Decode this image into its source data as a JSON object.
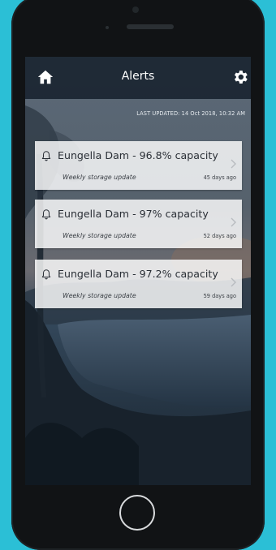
{
  "header": {
    "title": "Alerts",
    "left_icon": "home-icon",
    "right_icon": "gear-icon"
  },
  "last_updated": "LAST UPDATED: 14 Oct 2018, 10:32 AM",
  "alerts": [
    {
      "title": "Eungella Dam - 96.8% capacity",
      "subtitle": "Weekly storage update",
      "age": "45 days ago",
      "icon": "bell-icon"
    },
    {
      "title": "Eungella Dam - 97% capacity",
      "subtitle": "Weekly storage update",
      "age": "52 days ago",
      "icon": "bell-icon"
    },
    {
      "title": "Eungella Dam - 97.2% capacity",
      "subtitle": "Weekly storage update",
      "age": "59 days ago",
      "icon": "bell-icon"
    }
  ],
  "colors": {
    "page_background": "#2bbfd6",
    "device_frame": "#111315",
    "nav_bar": "#0e1824",
    "card_background": "#ffffff",
    "text_dark": "#2a2f36"
  }
}
